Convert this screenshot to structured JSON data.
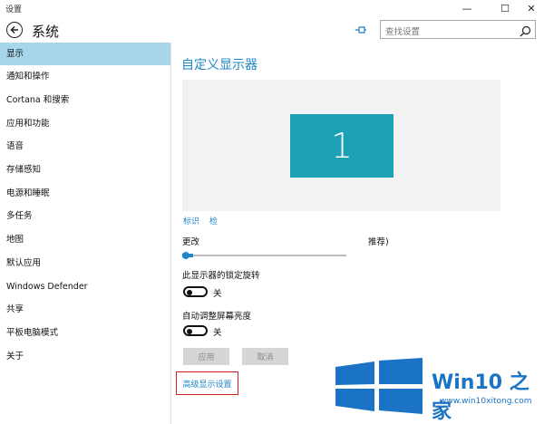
{
  "window": {
    "title": "设置",
    "minimize": "—",
    "maximize": "☐",
    "close": "✕"
  },
  "header": {
    "title": "系统",
    "search_placeholder": "查找设置"
  },
  "sidebar": {
    "items": [
      {
        "label": "显示",
        "active": true
      },
      {
        "label": "通知和操作"
      },
      {
        "label": "Cortana 和搜索"
      },
      {
        "label": "应用和功能"
      },
      {
        "label": "语音"
      },
      {
        "label": "存储感知"
      },
      {
        "label": "电源和睡眠"
      },
      {
        "label": "多任务"
      },
      {
        "label": "地图"
      },
      {
        "label": "默认应用"
      },
      {
        "label": "Windows Defender"
      },
      {
        "label": "共享"
      },
      {
        "label": "平板电脑模式"
      },
      {
        "label": "关于"
      }
    ]
  },
  "main": {
    "title": "自定义显示器",
    "monitor_number": "1",
    "identify_link": "标识",
    "detect_link": "检",
    "scale_label": "更改",
    "scale_suffix": "推荐)",
    "orientation_lock_label": "此显示器的锁定旋转",
    "orientation_toggle_state": "关",
    "auto_brightness_label": "自动调整屏幕亮度",
    "brightness_toggle_state": "关",
    "apply_button": "应用",
    "cancel_button": "取消",
    "advanced_link": "高级显示设置"
  },
  "watermark": {
    "brand": "Win10 之家",
    "url": "www.win10xitong.com"
  },
  "colors": {
    "accent": "#1e87c8",
    "active_nav": "#a7d6ea",
    "monitor": "#1ba1b3",
    "highlight_border": "#d62020"
  }
}
